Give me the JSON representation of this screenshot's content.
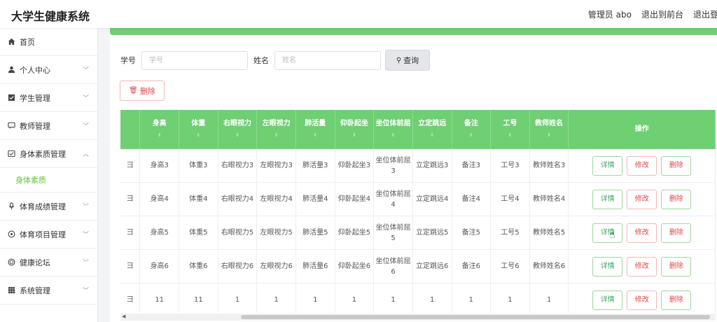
{
  "app": {
    "title": "大学生健康系统"
  },
  "topbar": {
    "user": "管理员 abo",
    "to_front": "退出到前台",
    "logout": "退出登录"
  },
  "sidebar": {
    "items": [
      {
        "label": "首页",
        "icon": "home-icon",
        "chevron": false
      },
      {
        "label": "个人中心",
        "icon": "user-icon",
        "chevron": true
      },
      {
        "label": "学生管理",
        "icon": "student-icon",
        "chevron": true
      },
      {
        "label": "教师管理",
        "icon": "chat-icon",
        "chevron": true
      },
      {
        "label": "身体素质管理",
        "icon": "fitness-icon",
        "chevron": true,
        "expanded": true
      },
      {
        "label": "体育成绩管理",
        "icon": "microphone-icon",
        "chevron": true
      },
      {
        "label": "体育项目管理",
        "icon": "target-icon",
        "chevron": true
      },
      {
        "label": "健康论坛",
        "icon": "forum-icon",
        "chevron": true
      },
      {
        "label": "系统管理",
        "icon": "grid-icon",
        "chevron": true
      }
    ],
    "submenu": {
      "label": "身体素质"
    }
  },
  "search": {
    "student_id_label": "学号",
    "student_id_placeholder": "学号",
    "name_label": "姓名",
    "name_placeholder": "姓名",
    "query_button": "查询"
  },
  "toolbar": {
    "delete_button": "删除"
  },
  "table": {
    "columns": [
      "",
      "身高",
      "体重",
      "右眼视力",
      "左眼视力",
      "肺活量",
      "仰卧起坐",
      "坐位体前屈",
      "立定跳远",
      "备注",
      "工号",
      "教师姓名",
      "操作"
    ],
    "rows": [
      [
        "彐",
        "身高3",
        "体重3",
        "右眼视力3",
        "左眼视力3",
        "肺活量3",
        "仰卧起坐3",
        "坐位体前屈3",
        "立定跳远3",
        "备注3",
        "工号3",
        "教师姓名3"
      ],
      [
        "彐",
        "身高4",
        "体重4",
        "右眼视力4",
        "左眼视力4",
        "肺活量4",
        "仰卧起坐4",
        "坐位体前屈4",
        "立定跳远4",
        "备注4",
        "工号4",
        "教师姓名4"
      ],
      [
        "彐",
        "身高5",
        "体重5",
        "右眼视力5",
        "左眼视力5",
        "肺活量5",
        "仰卧起坐5",
        "坐位体前屈5",
        "立定跳远5",
        "备注5",
        "工号5",
        "教师姓名5"
      ],
      [
        "彐",
        "身高6",
        "体重6",
        "右眼视力6",
        "左眼视力6",
        "肺活量6",
        "仰卧起坐6",
        "坐位体前屈6",
        "立定跳远6",
        "备注6",
        "工号6",
        "教师姓名6"
      ],
      [
        "彐",
        "11",
        "11",
        "1",
        "1",
        "1",
        "1",
        "1",
        "1",
        "1",
        "1",
        "1"
      ]
    ],
    "actions": {
      "detail": "详情",
      "edit": "修改",
      "delete": "删除"
    }
  },
  "colors": {
    "accent": "#6fcf73",
    "danger": "#e04848",
    "detail": "#3aa860"
  }
}
